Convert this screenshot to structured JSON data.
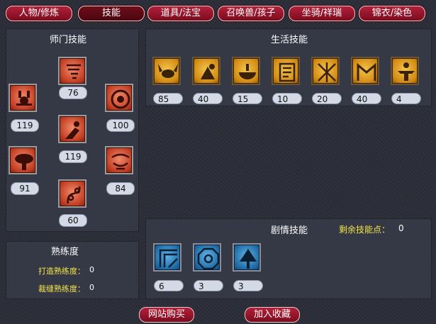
{
  "tabs": [
    {
      "label": "人物/修炼"
    },
    {
      "label": "技能"
    },
    {
      "label": "道具/法宝"
    },
    {
      "label": "召唤兽/孩子"
    },
    {
      "label": "坐骑/祥瑞"
    },
    {
      "label": "锦衣/染色"
    }
  ],
  "active_tab": "技能",
  "school_skills": {
    "title": "师门技能",
    "skills": [
      {
        "icon": "whirlwind-icon",
        "level": "76"
      },
      {
        "icon": "scorpion-icon",
        "level": "119"
      },
      {
        "icon": "coin-icon",
        "level": "100"
      },
      {
        "icon": "flying-figure-icon",
        "level": "119"
      },
      {
        "icon": "mushroom-icon",
        "level": "91"
      },
      {
        "icon": "swallow-icon",
        "level": "84"
      },
      {
        "icon": "vine-icon",
        "level": "60"
      }
    ]
  },
  "life_skills": {
    "title": "生活技能",
    "skills": [
      {
        "icon": "crab-icon",
        "level": "85"
      },
      {
        "icon": "herb-icon",
        "level": "40"
      },
      {
        "icon": "cooking-pot-icon",
        "level": "15"
      },
      {
        "icon": "talisman-icon",
        "level": "10"
      },
      {
        "icon": "lattice-icon",
        "level": "20"
      },
      {
        "icon": "gate-icon",
        "level": "40"
      },
      {
        "icon": "strongman-icon",
        "level": "4"
      }
    ]
  },
  "proficiency": {
    "title": "熟练度",
    "forging_label": "打造熟练度：",
    "forging_value": "0",
    "tailoring_label": "裁缝熟练度：",
    "tailoring_value": "0"
  },
  "story_skills": {
    "title": "剧情技能",
    "remaining_points_label": "剩余技能点：",
    "remaining_points_value": "0",
    "skills": [
      {
        "icon": "frame-icon",
        "level": "6"
      },
      {
        "icon": "octagon-icon",
        "level": "3"
      },
      {
        "icon": "tree-icon",
        "level": "3"
      }
    ]
  },
  "bottom_buttons": {
    "buy": "网站购买",
    "favorite": "加入收藏"
  }
}
